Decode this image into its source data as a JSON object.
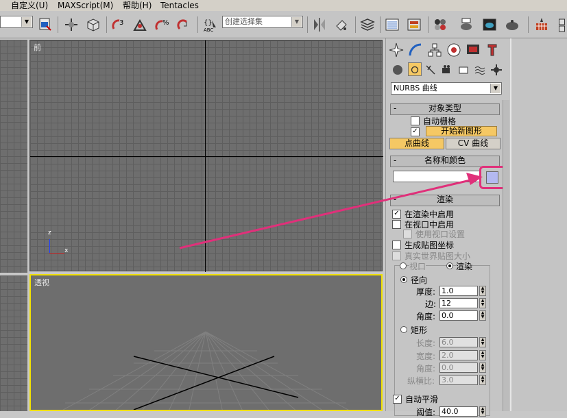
{
  "menu": {
    "items": [
      "自定义(U)",
      "MAXScript(M)",
      "帮助(H)",
      "Tentacles"
    ]
  },
  "toolbar": {
    "selection_set_placeholder": "创建选择集",
    "icons": [
      "select-icon",
      "select-object-icon",
      "angle-snap-icon",
      "snap-icon",
      "percent-snap-icon",
      "spinner-snap-icon",
      "named-sets-icon",
      "mirror-icon",
      "align-icon",
      "layers-icon",
      "curve-editor-icon",
      "schematic-icon",
      "material-editor-icon",
      "render-setup-icon",
      "render-frame-icon",
      "quick-render-icon",
      "extra-icon"
    ]
  },
  "viewports": {
    "front_label": "前",
    "perspective_label": "透视",
    "axis_z": "z",
    "axis_x": "x"
  },
  "panel": {
    "tabs": [
      "create-tab",
      "modify-tab",
      "hierarchy-tab",
      "motion-tab",
      "display-tab",
      "utilities-tab"
    ],
    "category_dropdown": "NURBS 曲线",
    "object_type": {
      "title": "对象类型",
      "minus": "-",
      "auto_grid": "自动栅格",
      "start_new_shape": "开始新图形",
      "point_curve": "点曲线",
      "cv_curve": "CV 曲线"
    },
    "name_color": {
      "title": "名称和颜色",
      "minus": "-",
      "name_value": "",
      "swatch_color": "#b4b9f0"
    },
    "render": {
      "title": "渲染",
      "minus": "-",
      "enable_in_render": "在渲染中启用",
      "enable_in_viewport": "在视口中启用",
      "use_viewport_settings": "使用视口设置",
      "gen_mapping": "生成贴图坐标",
      "real_world": "真实世界贴图大小",
      "viewport_radio": "视口",
      "render_radio": "渲染",
      "radial": "径向",
      "thickness_label": "厚度:",
      "thickness_value": "1.0",
      "sides_label": "边:",
      "sides_value": "12",
      "angle_label": "角度:",
      "angle_value": "0.0",
      "rect": "矩形",
      "length_label": "长度:",
      "length_value": "6.0",
      "width_label": "宽度:",
      "width_value": "2.0",
      "angle2_label": "角度:",
      "angle2_value": "0.0",
      "aspect_label": "纵横比:",
      "aspect_value": "3.0",
      "auto_smooth": "自动平滑",
      "threshold_label": "阈值:",
      "threshold_value": "40.0"
    }
  },
  "colors": {
    "highlight_box": "#e0307a",
    "arrow": "#e0307a",
    "active_button": "#f5c864",
    "viewport_active_border": "#f0e000"
  }
}
